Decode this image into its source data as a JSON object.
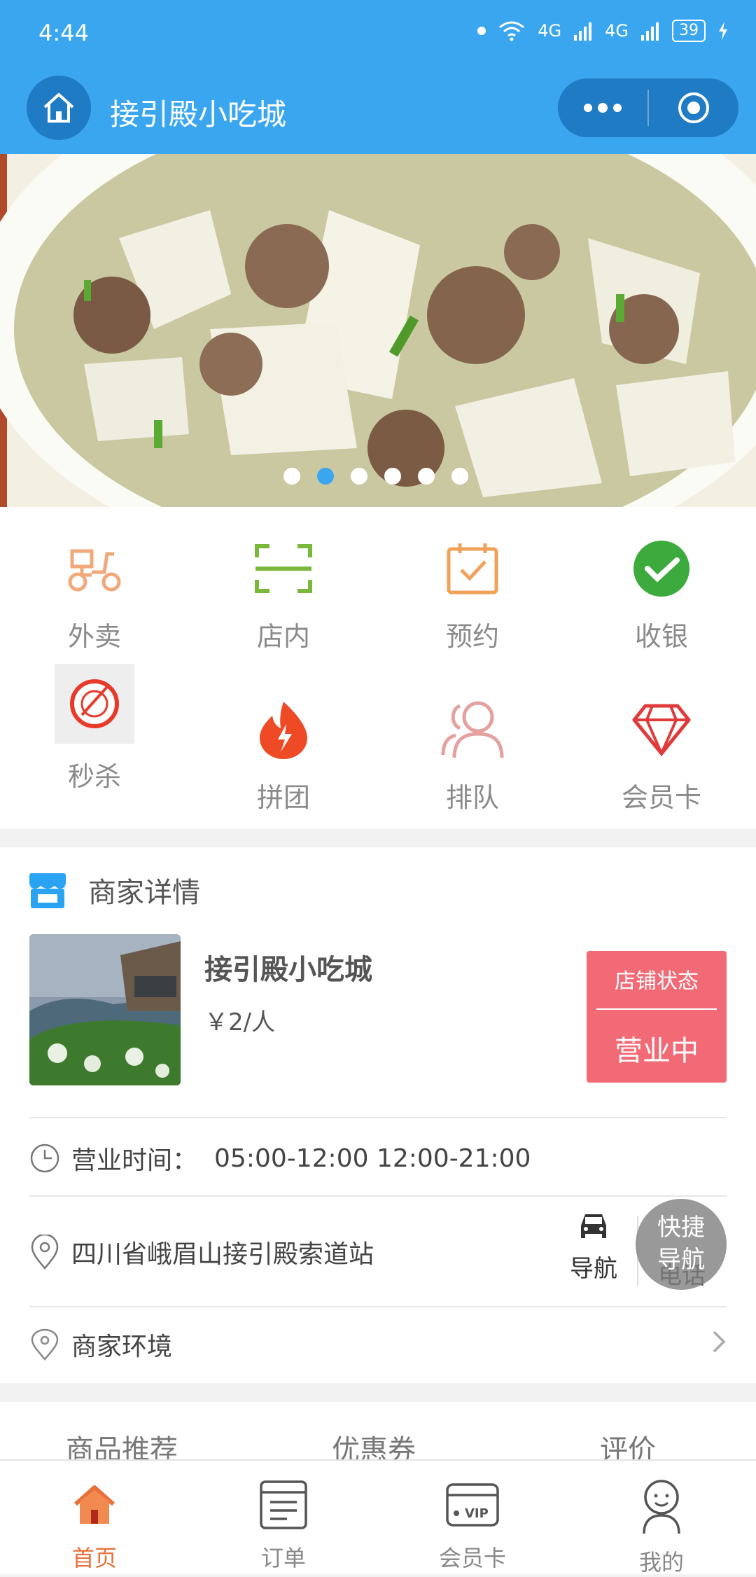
{
  "status_bar": {
    "time": "4:44",
    "signal1": "4G",
    "signal2": "4G",
    "battery": "39"
  },
  "header": {
    "title": "接引殿小吃城"
  },
  "banner": {
    "dots_total": 6,
    "active_dot": 2
  },
  "grid": [
    {
      "label": "外卖",
      "icon": "scooter-icon"
    },
    {
      "label": "店内",
      "icon": "scan-icon"
    },
    {
      "label": "预约",
      "icon": "calendar-check-icon"
    },
    {
      "label": "收银",
      "icon": "checkmark-circle-icon"
    },
    {
      "label": "秒杀",
      "icon": "flash-sale-icon"
    },
    {
      "label": "拼团",
      "icon": "fire-icon"
    },
    {
      "label": "排队",
      "icon": "people-icon"
    },
    {
      "label": "会员卡",
      "icon": "diamond-icon"
    }
  ],
  "merchant": {
    "section_title": "商家详情",
    "name": "接引殿小吃城",
    "price": "￥2/人",
    "state_label": "店铺状态",
    "state_value": "营业中",
    "hours_label": "营业时间：",
    "hours_value": "05:00-12:00   12:00-21:00",
    "address": "四川省峨眉山接引殿索道站",
    "nav_label": "导航",
    "phone_label": "电话",
    "fab_line1": "快捷",
    "fab_line2": "导航",
    "env_label": "商家环境"
  },
  "tabs": [
    "商品推荐",
    "优惠券",
    "评价"
  ],
  "bottom_nav": [
    {
      "label": "首页",
      "icon": "home-icon",
      "active": true
    },
    {
      "label": "订单",
      "icon": "order-icon",
      "active": false
    },
    {
      "label": "会员卡",
      "icon": "vip-card-icon",
      "active": false
    },
    {
      "label": "我的",
      "icon": "profile-icon",
      "active": false
    }
  ],
  "colors": {
    "primary": "#3ba6f0",
    "status_red": "#f26a75",
    "active_tab": "#e8703a"
  }
}
